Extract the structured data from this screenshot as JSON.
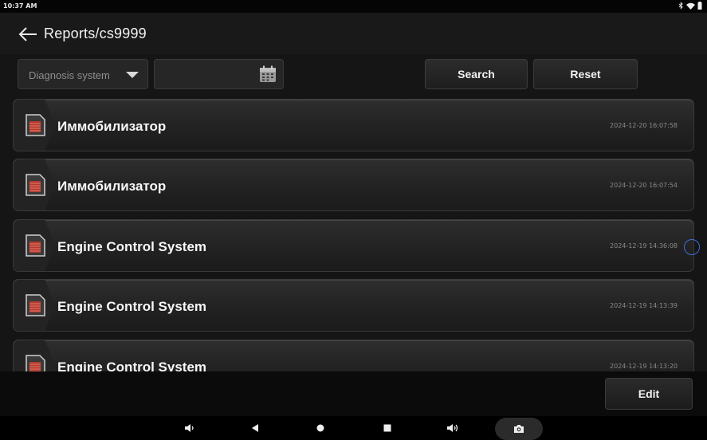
{
  "status_bar": {
    "time": "10:37 AM",
    "icons": [
      "bluetooth-icon",
      "wifi-icon",
      "battery-icon"
    ]
  },
  "header": {
    "title": "Reports/cs9999",
    "back_icon": "arrow-left-icon"
  },
  "filters": {
    "system_dropdown": {
      "value": "Diagnosis system",
      "icon": "caret-down-icon"
    },
    "date_field": {
      "value": "",
      "icon": "calendar-icon"
    },
    "search_label": "Search",
    "reset_label": "Reset"
  },
  "reports": [
    {
      "name": "Иммобилизатор",
      "date": "2024-12-20 16:07:58"
    },
    {
      "name": "Иммобилизатор",
      "date": "2024-12-20 16:07:54"
    },
    {
      "name": "Engine Control System",
      "date": "2024-12-19 14:36:08"
    },
    {
      "name": "Engine Control System",
      "date": "2024-12-19 14:13:39"
    },
    {
      "name": "Engine Control System",
      "date": "2024-12-19 14:13:20"
    }
  ],
  "footer": {
    "edit_label": "Edit"
  },
  "nav_bar": {
    "icons": [
      "volume-down-icon",
      "back-triangle-icon",
      "home-circle-icon",
      "recents-square-icon",
      "volume-up-icon",
      "camera-icon"
    ]
  },
  "colors": {
    "background": "#151515",
    "accent_red": "#c0392b",
    "scroll_indicator": "#3b6fd8"
  }
}
